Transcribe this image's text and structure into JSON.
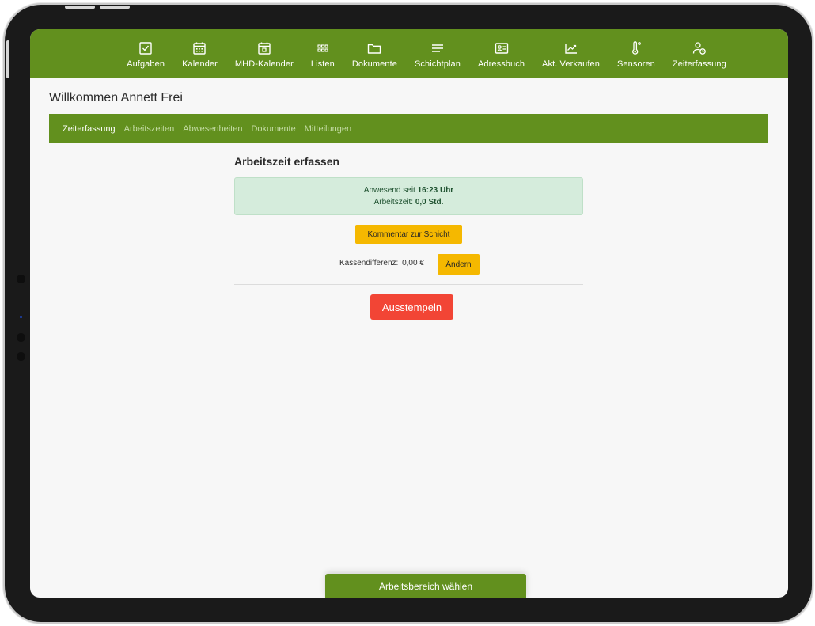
{
  "topnav": {
    "items": [
      {
        "label": "Aufgaben",
        "icon": "checkbox-icon"
      },
      {
        "label": "Kalender",
        "icon": "calendar-icon"
      },
      {
        "label": "MHD-Kalender",
        "icon": "calendar-date-icon"
      },
      {
        "label": "Listen",
        "icon": "grid-icon"
      },
      {
        "label": "Dokumente",
        "icon": "folder-icon"
      },
      {
        "label": "Schichtplan",
        "icon": "lines-icon"
      },
      {
        "label": "Adressbuch",
        "icon": "contact-card-icon"
      },
      {
        "label": "Akt. Verkaufen",
        "icon": "trend-chart-icon"
      },
      {
        "label": "Sensoren",
        "icon": "thermometer-icon"
      },
      {
        "label": "Zeiterfassung",
        "icon": "user-clock-icon"
      }
    ]
  },
  "welcome": "Willkommen Annett Frei",
  "subnav": {
    "items": [
      "Zeiterfassung",
      "Arbeitszeiten",
      "Abwesenheiten",
      "Dokumente",
      "Mitteilungen"
    ],
    "active": "Zeiterfassung"
  },
  "timeclock": {
    "title": "Arbeitszeit erfassen",
    "present_prefix": "Anwesend seit",
    "present_time": "16:23 Uhr",
    "worktime_prefix": "Arbeitszeit:",
    "worktime_value": "0,0 Std.",
    "comment_button": "Kommentar zur Schicht",
    "cash_diff_label": "Kassendifferenz:",
    "cash_diff_value": "0,00 €",
    "change_button": "Ändern",
    "clockout_button": "Ausstempeln"
  },
  "footer": {
    "area_button": "Arbeitsbereich wählen"
  },
  "colors": {
    "brand_green": "#62901e",
    "status_bg": "#d5ecdc",
    "accent_yellow": "#f5b800",
    "danger_red": "#f24535"
  }
}
